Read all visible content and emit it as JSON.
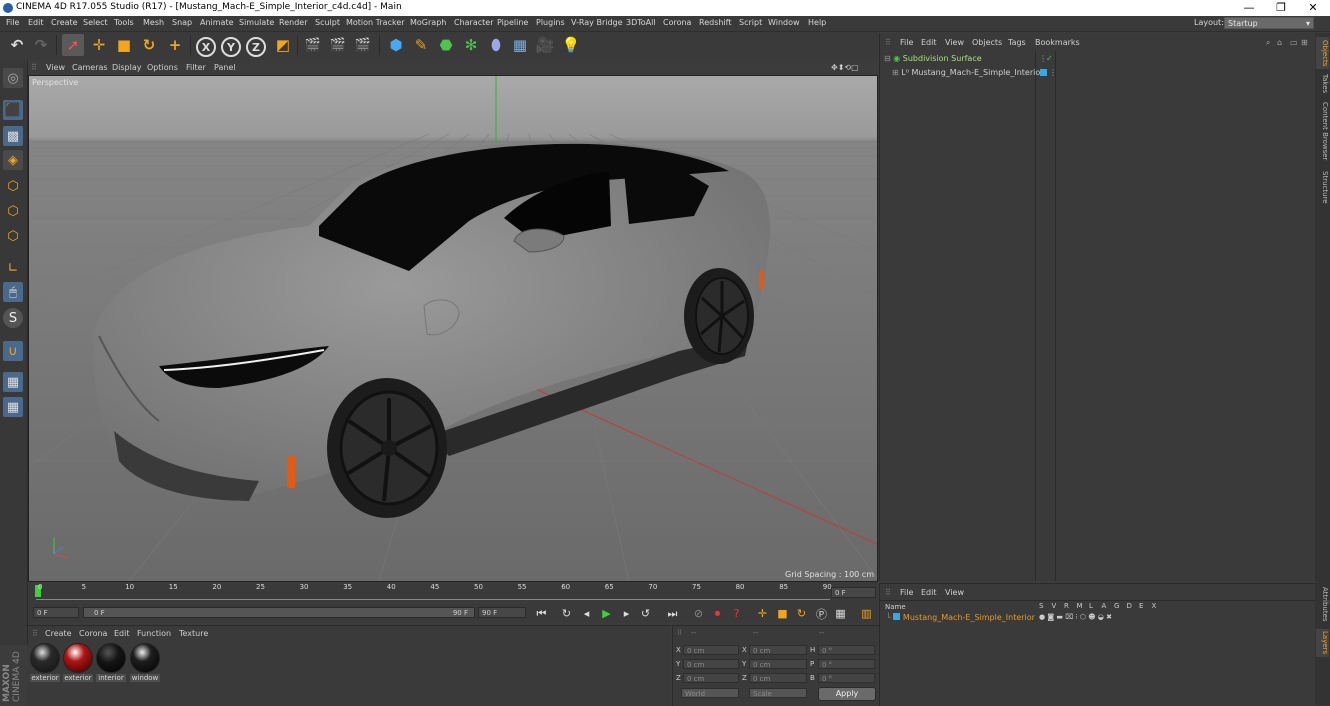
{
  "window": {
    "title": "CINEMA 4D R17.055 Studio (R17) - [Mustang_Mach-E_Simple_Interior_c4d.c4d] - Main"
  },
  "menu": [
    "File",
    "Edit",
    "Create",
    "Select",
    "Tools",
    "Mesh",
    "Snap",
    "Animate",
    "Simulate",
    "Render",
    "Sculpt",
    "Motion Tracker",
    "MoGraph",
    "Character",
    "Pipeline",
    "Plugins",
    "V-Ray Bridge",
    "3DToAll",
    "Corona",
    "Redshift",
    "Script",
    "Window",
    "Help"
  ],
  "layout": {
    "label": "Layout:",
    "value": "Startup"
  },
  "toolbar_icons": [
    "undo-icon",
    "redo-icon",
    "select-pointer-icon",
    "move-icon",
    "scale-icon",
    "rotate-icon",
    "add-icon",
    "x-axis-icon",
    "y-axis-icon",
    "z-axis-icon",
    "world-coord-icon",
    "render-view-icon",
    "render-picture-viewer-icon",
    "render-settings-icon",
    "cube-icon",
    "pen-icon",
    "subdivision-icon",
    "array-icon",
    "deformer-icon",
    "floor-icon",
    "camera-icon",
    "light-icon"
  ],
  "toolbar_axis": {
    "x": "X",
    "y": "Y",
    "z": "Z"
  },
  "left_palette": [
    "make-editable-icon",
    "model-mode-icon",
    "texture-mode-icon",
    "workplane-icon",
    "points-mode-icon",
    "edges-mode-icon",
    "polygons-mode-icon",
    "axis-mode-icon",
    "tweak-mode-icon",
    "solo-icon",
    "snap-icon",
    "locked-workplane-icon",
    "planar-workplane-icon"
  ],
  "viewport": {
    "menu": [
      "View",
      "Cameras",
      "Display",
      "Options",
      "Filter",
      "Panel"
    ],
    "label": "Perspective",
    "grid_spacing": "Grid Spacing : 100 cm"
  },
  "timeline": {
    "ticks": [
      "0",
      "5",
      "10",
      "15",
      "20",
      "25",
      "30",
      "35",
      "40",
      "45",
      "50",
      "55",
      "60",
      "65",
      "70",
      "75",
      "80",
      "85",
      "90"
    ],
    "current_frame": "0 F"
  },
  "transport": {
    "start": "0 F",
    "slider_start": "0 F",
    "slider_end": "90 F",
    "end": "90 F"
  },
  "materials": {
    "menu": [
      "Create",
      "Corona",
      "Edit",
      "Function",
      "Texture"
    ],
    "items": [
      {
        "name": "exterior",
        "color": "#2a2a2a"
      },
      {
        "name": "exterior",
        "color": "#b01515"
      },
      {
        "name": "interior",
        "color": "#151515"
      },
      {
        "name": "window",
        "color": "#1e1e1e"
      }
    ]
  },
  "coords": {
    "headers": [
      "--",
      "--",
      "--"
    ],
    "rows": [
      {
        "a": "X",
        "av": "0 cm",
        "b": "X",
        "bv": "0 cm",
        "c": "H",
        "cv": "0 °"
      },
      {
        "a": "Y",
        "av": "0 cm",
        "b": "Y",
        "bv": "0 cm",
        "c": "P",
        "cv": "0 °"
      },
      {
        "a": "Z",
        "av": "0 cm",
        "b": "Z",
        "bv": "0 cm",
        "c": "B",
        "cv": "0 °"
      }
    ],
    "mode1": "World",
    "mode2": "Scale",
    "apply": "Apply"
  },
  "object_manager": {
    "menu": [
      "File",
      "Edit",
      "View",
      "Objects",
      "Tags",
      "Bookmarks"
    ],
    "objects": [
      {
        "name": "Subdivision Surface",
        "color": "#a8e07a"
      },
      {
        "name": "Mustang_Mach-E_Simple_Interior",
        "color": "#cfcfcf"
      }
    ]
  },
  "layer_manager": {
    "menu": [
      "File",
      "Edit",
      "View"
    ],
    "col_name": "Name",
    "cols": [
      "S",
      "V",
      "R",
      "M",
      "L",
      "A",
      "G",
      "D",
      "E",
      "X"
    ],
    "layers": [
      {
        "name": "Mustang_Mach-E_Simple_Interior",
        "color": "#e39b2a"
      }
    ]
  },
  "right_tabs": [
    "Objects",
    "Takes",
    "Content Browser",
    "Structure",
    "Attributes",
    "Layers"
  ],
  "branding": {
    "line1": "MAXON",
    "line2": "CINEMA 4D"
  }
}
